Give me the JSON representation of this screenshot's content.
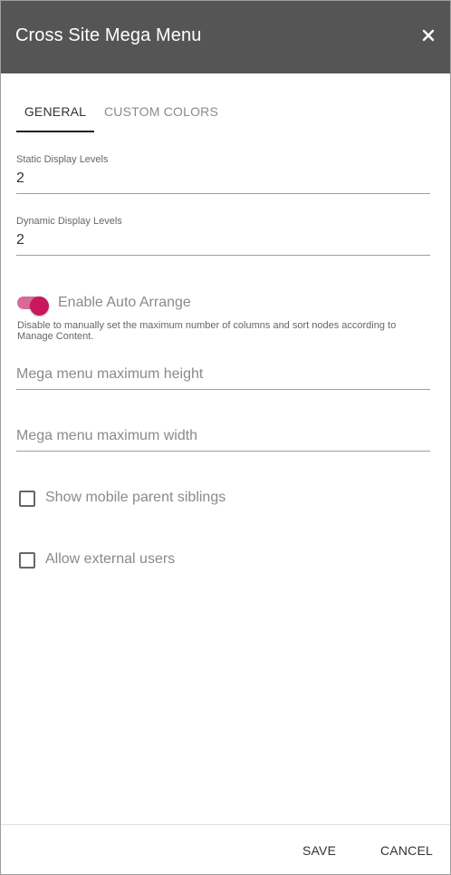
{
  "dialog": {
    "title": "Cross Site Mega Menu",
    "close_icon": "close-icon"
  },
  "tabs": [
    {
      "label": "GENERAL",
      "active": true
    },
    {
      "label": "CUSTOM COLORS",
      "active": false
    }
  ],
  "fields": {
    "static_display_levels": {
      "label": "Static Display Levels",
      "value": "2"
    },
    "dynamic_display_levels": {
      "label": "Dynamic Display Levels",
      "value": "2"
    },
    "max_height": {
      "placeholder": "Mega menu maximum height"
    },
    "max_width": {
      "placeholder": "Mega menu maximum width"
    }
  },
  "auto_arrange": {
    "label": "Enable Auto Arrange",
    "enabled": true,
    "hint": "Disable to manually set the maximum number of columns and sort nodes according to Manage Content."
  },
  "checkboxes": {
    "mobile_parent_siblings": {
      "label": "Show mobile parent siblings",
      "checked": false
    },
    "external_users": {
      "label": "Allow external users",
      "checked": false
    }
  },
  "footer": {
    "save_label": "SAVE",
    "cancel_label": "CANCEL"
  },
  "colors": {
    "header_bg": "#555555",
    "accent": "#c7185d",
    "accent_track": "#d96a96"
  }
}
